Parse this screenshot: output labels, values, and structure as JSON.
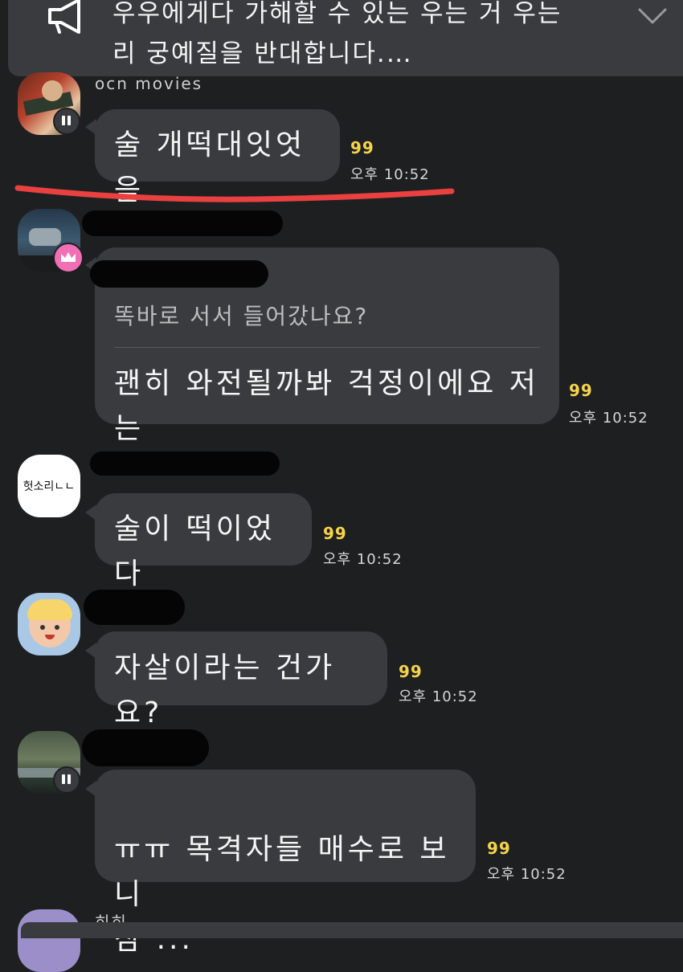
{
  "notice": {
    "icon": "megaphone-icon",
    "text": "우우에게다 가해할 수 있는 우는 거 우는\n리 궁예질을 반대합니다.…"
  },
  "messages": [
    {
      "sender": "ocn movies",
      "text": "술 개떡대잇엇음",
      "unread": "99",
      "time": "오후 10:52"
    },
    {
      "quote": "똑바로 서서 들어갔나요?",
      "text": "괜히 와전될까봐 걱정이에요 저는",
      "unread": "99",
      "time": "오후 10:52"
    },
    {
      "avatar_text": "헛소리ㄴㄴ",
      "text": "술이 떡이었다",
      "unread": "99",
      "time": "오후 10:52"
    },
    {
      "text": "자살이라는 건가요?",
      "unread": "99",
      "time": "오후 10:52"
    },
    {
      "text": "ㅠㅠ 목격자들 매수로 보니\n참 ...",
      "unread": "99",
      "time": "오후 10:52"
    },
    {
      "sender": "히히"
    }
  ],
  "colors": {
    "background": "#1e1f21",
    "bubble": "#3a3b3e",
    "unread": "#f6d44a",
    "highlight": "#e8413f",
    "crown_badge": "#f06fb5"
  }
}
